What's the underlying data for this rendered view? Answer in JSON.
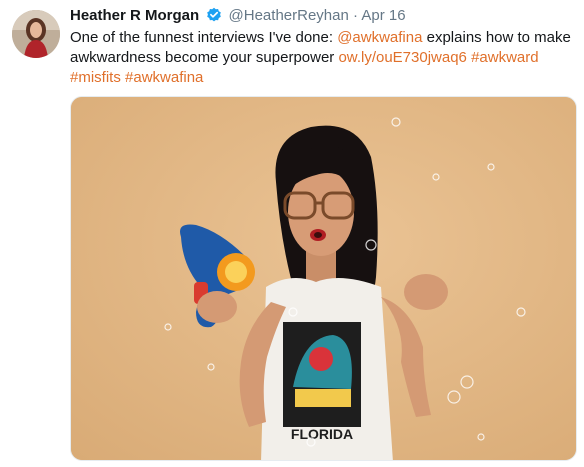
{
  "tweet": {
    "author_name": "Heather R Morgan",
    "author_handle": "@HeatherReyhan",
    "separator": "·",
    "date": "Apr 16",
    "text_part1": "One of the funnest interviews I've done: ",
    "mention": "@awkwafina",
    "text_part2": " explains how to make awkwardness become your superpower ",
    "link": "ow.ly/ouE730jwaq6",
    "hashtag1": "#awkward",
    "hashtag2": "#misfits",
    "hashtag3": "#awkwafina"
  },
  "photo": {
    "shirt_text": "FLORIDA"
  },
  "icons": {
    "verified": "verified-badge-icon"
  },
  "colors": {
    "link": "#e0702b",
    "verified": "#1da1f2",
    "muted": "#657786"
  }
}
